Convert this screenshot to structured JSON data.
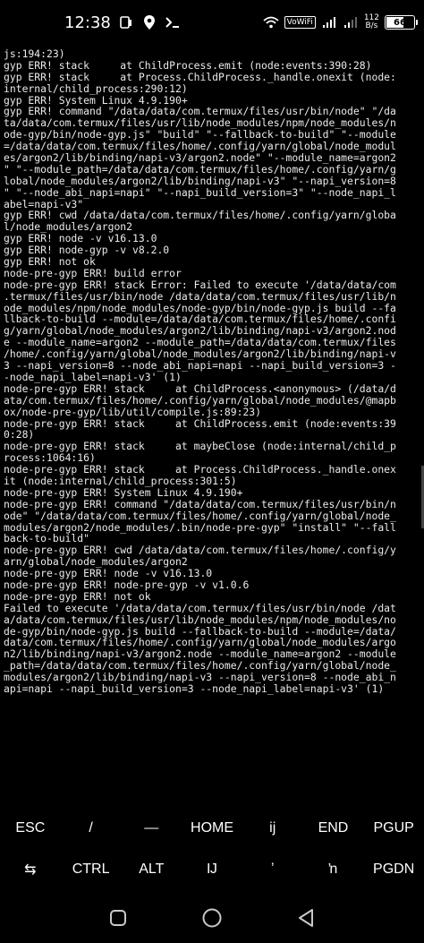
{
  "status_bar": {
    "time": "12:38",
    "volte": "VoWiFi",
    "net_speed_value": "112",
    "net_speed_unit": "B/s",
    "battery": "66",
    "battery_level": 0.66
  },
  "terminal": {
    "lines": [
      "js:194:23)",
      "gyp ERR! stack     at ChildProcess.emit (node:events:390:28)",
      "gyp ERR! stack     at Process.ChildProcess._handle.onexit (node:",
      "internal/child_process:290:12)",
      "gyp ERR! System Linux 4.9.190+",
      "gyp ERR! command \"/data/data/com.termux/files/usr/bin/node\" \"/da",
      "ta/data/com.termux/files/usr/lib/node_modules/npm/node_modules/n",
      "ode-gyp/bin/node-gyp.js\" \"build\" \"--fallback-to-build\" \"--module",
      "=/data/data/com.termux/files/home/.config/yarn/global/node_modul",
      "es/argon2/lib/binding/napi-v3/argon2.node\" \"--module_name=argon2",
      "\" \"--module_path=/data/data/com.termux/files/home/.config/yarn/g",
      "lobal/node_modules/argon2/lib/binding/napi-v3\" \"--napi_version=8",
      "\" \"--node_abi_napi=napi\" \"--napi_build_version=3\" \"--node_napi_l",
      "abel=napi-v3\"",
      "gyp ERR! cwd /data/data/com.termux/files/home/.config/yarn/globa",
      "l/node_modules/argon2",
      "gyp ERR! node -v v16.13.0",
      "gyp ERR! node-gyp -v v8.2.0",
      "gyp ERR! not ok",
      "node-pre-gyp ERR! build error",
      "node-pre-gyp ERR! stack Error: Failed to execute '/data/data/com",
      ".termux/files/usr/bin/node /data/data/com.termux/files/usr/lib/n",
      "ode_modules/npm/node_modules/node-gyp/bin/node-gyp.js build --fa",
      "llback-to-build --module=/data/data/com.termux/files/home/.confi",
      "g/yarn/global/node_modules/argon2/lib/binding/napi-v3/argon2.nod",
      "e --module_name=argon2 --module_path=/data/data/com.termux/files",
      "/home/.config/yarn/global/node_modules/argon2/lib/binding/napi-v",
      "3 --napi_version=8 --node_abi_napi=napi --napi_build_version=3 -",
      "-node_napi_label=napi-v3' (1)",
      "node-pre-gyp ERR! stack     at ChildProcess.<anonymous> (/data/d",
      "ata/com.termux/files/home/.config/yarn/global/node_modules/@mapb",
      "ox/node-pre-gyp/lib/util/compile.js:89:23)",
      "node-pre-gyp ERR! stack     at ChildProcess.emit (node:events:39",
      "0:28)",
      "node-pre-gyp ERR! stack     at maybeClose (node:internal/child_p",
      "rocess:1064:16)",
      "node-pre-gyp ERR! stack     at Process.ChildProcess._handle.onex",
      "it (node:internal/child_process:301:5)",
      "node-pre-gyp ERR! System Linux 4.9.190+",
      "node-pre-gyp ERR! command \"/data/data/com.termux/files/usr/bin/n",
      "ode\" \"/data/data/com.termux/files/home/.config/yarn/global/node_",
      "modules/argon2/node_modules/.bin/node-pre-gyp\" \"install\" \"--fall",
      "back-to-build\"",
      "node-pre-gyp ERR! cwd /data/data/com.termux/files/home/.config/y",
      "arn/global/node_modules/argon2",
      "node-pre-gyp ERR! node -v v16.13.0",
      "node-pre-gyp ERR! node-pre-gyp -v v1.0.6",
      "node-pre-gyp ERR! not ok",
      "Failed to execute '/data/data/com.termux/files/usr/bin/node /dat",
      "a/data/com.termux/files/usr/lib/node_modules/npm/node_modules/no",
      "de-gyp/bin/node-gyp.js build --fallback-to-build --module=/data/",
      "data/com.termux/files/home/.config/yarn/global/node_modules/argo",
      "n2/lib/binding/napi-v3/argon2.node --module_name=argon2 --module",
      "_path=/data/data/com.termux/files/home/.config/yarn/global/node_",
      "modules/argon2/lib/binding/napi-v3 --napi_version=8 --node_abi_n",
      "api=napi --napi_build_version=3 --node_napi_label=napi-v3' (1)"
    ]
  },
  "extra_keys": {
    "row1": [
      {
        "name": "key-esc",
        "label": "ESC"
      },
      {
        "name": "key-slash",
        "label": "/"
      },
      {
        "name": "key-dash",
        "label": "—"
      },
      {
        "name": "key-home",
        "label": "HOME"
      },
      {
        "name": "key-ij",
        "label": "ij"
      },
      {
        "name": "key-end",
        "label": "END"
      },
      {
        "name": "key-pgup",
        "label": "PGUP"
      }
    ],
    "row2": [
      {
        "name": "key-tab",
        "label": "⇆"
      },
      {
        "name": "key-ctrl",
        "label": "CTRL"
      },
      {
        "name": "key-alt",
        "label": "ALT"
      },
      {
        "name": "key-ij-ligature",
        "label": "Ĳ"
      },
      {
        "name": "key-apostrophe",
        "label": "ʼ"
      },
      {
        "name": "key-n-apostrophe",
        "label": "ŉ"
      },
      {
        "name": "key-pgdn",
        "label": "PGDN"
      }
    ]
  },
  "nav_bar": {
    "icons": [
      "recents-icon",
      "home-icon",
      "back-icon"
    ]
  }
}
